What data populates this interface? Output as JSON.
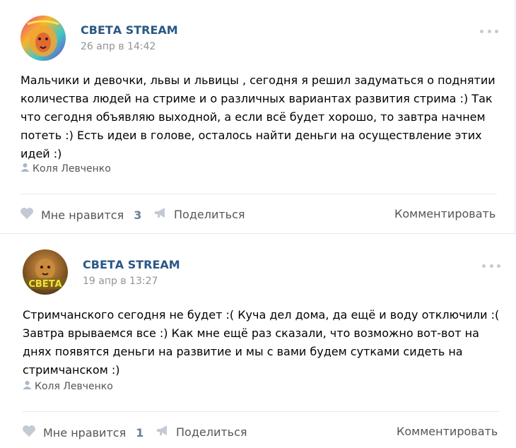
{
  "posts": [
    {
      "author": "СВЕТА STREAM",
      "date": "26 апр в 14:42",
      "text": "Мальчики и девочки, львы и львицы , сегодня я решил задуматься о поднятии количества людей на стриме и о различных вариантах развития стрима :) Так что сегодня объявляю выходной, а если всё будет хорошо, то завтра начнем потеть :) Есть идеи в голове, осталось найти деньги на осуществление этих идей :)",
      "signer": "Коля Левченко",
      "like_label": "Мне нравится",
      "like_count": "3",
      "share_label": "Поделиться",
      "comment_label": "Комментировать",
      "avatar_icon": "lion-avatar-icon"
    },
    {
      "author": "СВЕТА STREAM",
      "date": "19 апр в 13:27",
      "text": "Стримчанского сегодня не будет :( Куча дел дома, да ещё и воду отключили :( Завтра врываемся все :) Как мне ещё раз сказали, что возможно вот-вот на днях появятся деньги на развитие и мы с вами будем сутками сидеть на стримчанском :)",
      "signer": "Коля Левченко",
      "like_label": "Мне нравится",
      "like_count": "1",
      "share_label": "Поделиться",
      "comment_label": "Комментировать",
      "avatar_icon": "lion-avatar-icon",
      "avatar_text": "СВЕТА"
    }
  ],
  "colors": {
    "author": "#2a5885",
    "date": "#939393",
    "icon": "#c3cad3",
    "action_text": "#555555"
  }
}
